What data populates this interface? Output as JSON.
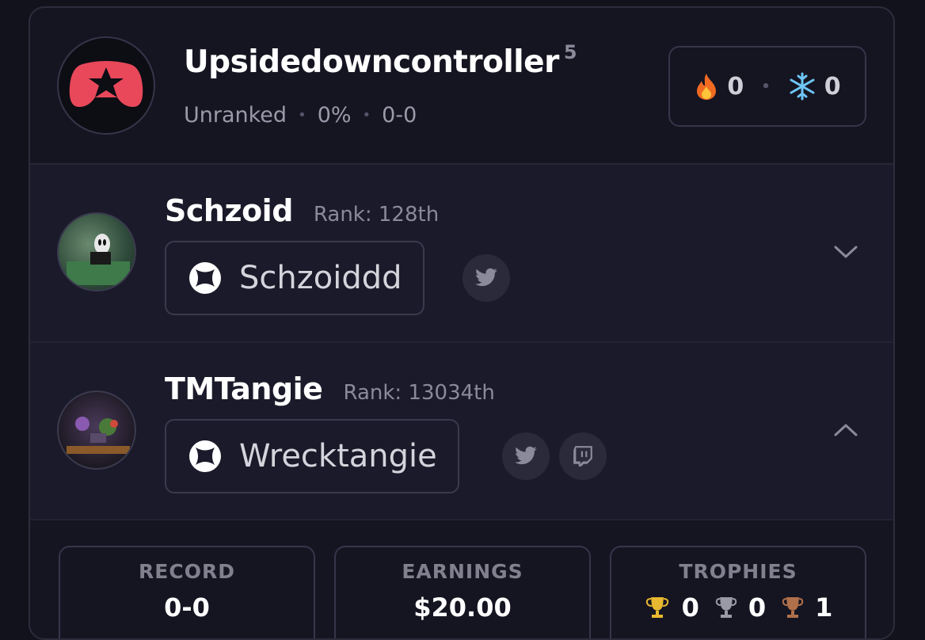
{
  "team": {
    "name": "Upsidedowncontroller",
    "level": "5",
    "rank_status": "Unranked",
    "win_pct": "0%",
    "record": "0-0",
    "streaks": {
      "hot": "0",
      "cold": "0"
    },
    "colors": {
      "logo": "#e8485a"
    }
  },
  "players": [
    {
      "name": "Schzoid",
      "rank": "Rank: 128th",
      "platform_icon": "xbox-icon",
      "gamertag": "Schzoiddd",
      "socials": [
        "twitter-icon"
      ],
      "expanded": false
    },
    {
      "name": "TMTangie",
      "rank": "Rank: 13034th",
      "platform_icon": "xbox-icon",
      "gamertag": "Wrecktangie",
      "socials": [
        "twitter-icon",
        "twitch-icon"
      ],
      "expanded": true
    }
  ],
  "stats": {
    "record_label": "RECORD",
    "record_value": "0-0",
    "earnings_label": "EARNINGS",
    "earnings_value": "$20.00",
    "trophies_label": "TROPHIES",
    "trophies": {
      "gold": "0",
      "silver": "0",
      "bronze": "1"
    }
  }
}
